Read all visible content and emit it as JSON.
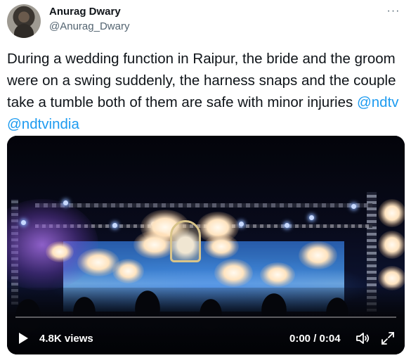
{
  "author": {
    "display_name": "Anurag Dwary",
    "handle": "@Anurag_Dwary",
    "avatar_icon": "profile-photo"
  },
  "more_menu": {
    "icon": "more-horizontal-icon",
    "glyph": "···"
  },
  "tweet": {
    "text": "During a wedding function in Raipur, the bride and the groom were on a swing suddenly, the harness snaps and the couple take a tumble both of them are safe with minor injuries",
    "mentions": [
      "@ndtv",
      "@ndtvindia"
    ]
  },
  "video": {
    "views": "4.8K views",
    "time": "0:00 / 0:04",
    "progress_fraction": 0.0,
    "play_icon": "play-icon",
    "volume_icon": "volume-icon",
    "fullscreen_icon": "fullscreen-icon"
  },
  "colors": {
    "link": "#1d9bf0",
    "secondary_text": "#536471",
    "primary_text": "#0f1419"
  }
}
